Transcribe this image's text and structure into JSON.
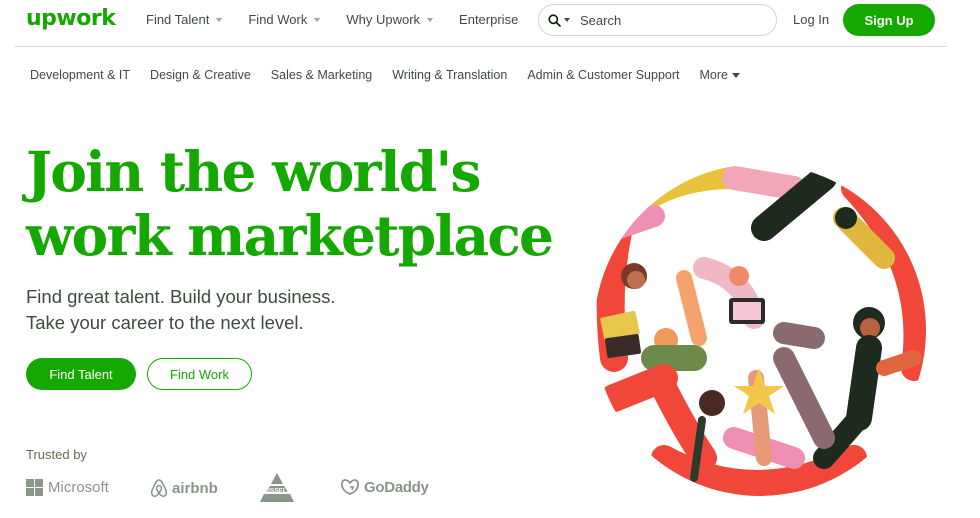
{
  "brand": {
    "logo_text": "upwork",
    "accent": "#14a800"
  },
  "nav": {
    "items": [
      {
        "label": "Find Talent",
        "has_caret": true
      },
      {
        "label": "Find Work",
        "has_caret": true
      },
      {
        "label": "Why Upwork",
        "has_caret": true
      },
      {
        "label": "Enterprise",
        "has_caret": false
      }
    ],
    "search": {
      "placeholder": "Search",
      "icon": "search-icon"
    },
    "login_label": "Log In",
    "signup_label": "Sign Up"
  },
  "categories": {
    "items": [
      "Development & IT",
      "Design & Creative",
      "Sales & Marketing",
      "Writing & Translation",
      "Admin & Customer Support"
    ],
    "more_label": "More"
  },
  "hero": {
    "headline_line1": "Join the world's",
    "headline_line2": "work marketplace",
    "sub_line1": "Find great talent. Build your business.",
    "sub_line2": "Take your career to the next level.",
    "primary_cta": "Find Talent",
    "secondary_cta": "Find Work"
  },
  "trusted": {
    "label": "Trusted by",
    "logos": [
      "Microsoft",
      "airbnb",
      "BISSELL",
      "GoDaddy"
    ]
  }
}
